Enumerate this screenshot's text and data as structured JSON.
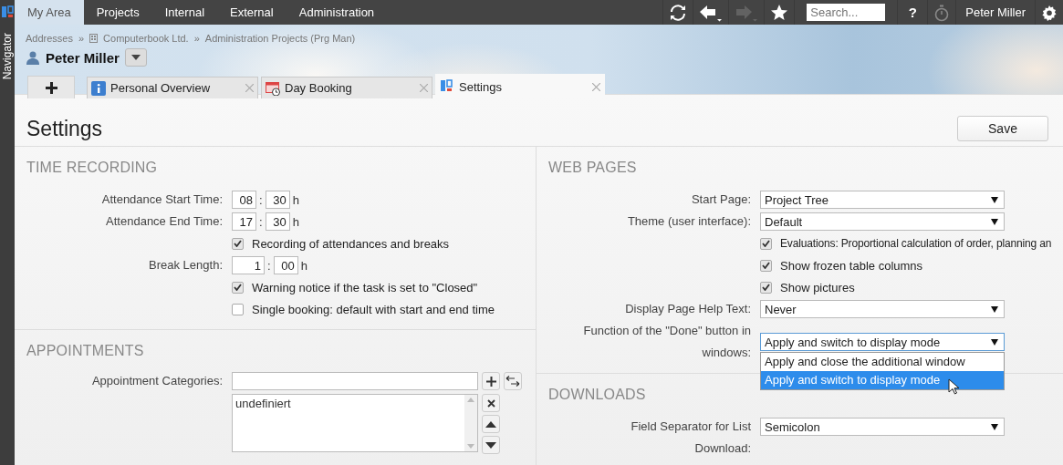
{
  "sidebar": {
    "label": "Navigator"
  },
  "menu": [
    {
      "label": "My Area",
      "selected": true
    },
    {
      "label": "Projects",
      "selected": false
    },
    {
      "label": "Internal",
      "selected": false
    },
    {
      "label": "External",
      "selected": false
    },
    {
      "label": "Administration",
      "selected": false
    }
  ],
  "toolbar": {
    "forward_disabled": true,
    "search": {
      "placeholder": "Search..."
    },
    "help": "?",
    "user": "Peter Miller"
  },
  "breadcrumbs": {
    "separator": "»",
    "items": [
      {
        "label": "Addresses",
        "kind": "plain"
      },
      {
        "label": "Computerbook Ltd.",
        "kind": "company"
      },
      {
        "label": "Administration Projects (Prg Man)",
        "kind": "plain"
      }
    ]
  },
  "person": {
    "name": "Peter Miller"
  },
  "tabs": [
    {
      "label": "Personal Overview",
      "kind": "info",
      "selected": false
    },
    {
      "label": "Day Booking",
      "kind": "calendar",
      "selected": false
    },
    {
      "label": "Settings",
      "kind": "settings",
      "selected": true
    }
  ],
  "page": {
    "title": "Settings",
    "save": "Save"
  },
  "left_column": [
    {
      "title": "TIME RECORDING",
      "rows": [
        {
          "kind": "time",
          "label": "Attendance Start Time:",
          "hours": "08",
          "separator": ":",
          "minutes": "30",
          "unit": "h"
        },
        {
          "kind": "time",
          "label": "Attendance End Time:",
          "hours": "17",
          "separator": ":",
          "minutes": "30",
          "unit": "h"
        },
        {
          "kind": "checkbox",
          "label": "Recording of attendances and breaks",
          "checked": true
        },
        {
          "kind": "time",
          "label": "Break Length:",
          "hours": "1",
          "separator": ":",
          "minutes": "00",
          "unit": "h"
        },
        {
          "kind": "checkbox",
          "label": "Warning notice if the task is set to \"Closed\"",
          "checked": true
        },
        {
          "kind": "checkbox",
          "label": "Single booking: default with start and end time",
          "checked": false
        }
      ]
    },
    {
      "title": "APPOINTMENTS",
      "rows": [
        {
          "kind": "list",
          "label": "Appointment Categories:",
          "items": [
            "undefiniert"
          ]
        }
      ]
    }
  ],
  "right_column": [
    {
      "title": "WEB PAGES",
      "rows": [
        {
          "kind": "select",
          "label": "Start Page:",
          "value": "Project Tree",
          "open": false
        },
        {
          "kind": "select",
          "label": "Theme (user interface):",
          "value": "Default",
          "open": false
        },
        {
          "kind": "checkbox",
          "label": "Evaluations: Proportional calculation of order, planning an",
          "checked": true
        },
        {
          "kind": "checkbox",
          "label": "Show frozen table columns",
          "checked": true
        },
        {
          "kind": "checkbox",
          "label": "Show pictures",
          "checked": true
        },
        {
          "kind": "select",
          "label": "Display Page Help Text:",
          "value": "Never",
          "open": false
        },
        {
          "kind": "select",
          "label": "Function of the \"Done\" button in windows:",
          "value": "Apply and switch to display mode",
          "open": true,
          "options": [
            {
              "label": "Apply and close the additional window",
              "selected": false
            },
            {
              "label": "Apply and switch to display mode",
              "selected": true
            }
          ]
        }
      ]
    },
    {
      "title": "DOWNLOADS",
      "rows": [
        {
          "kind": "select",
          "label": "Field Separator for List",
          "value": "Semicolon",
          "open": false
        },
        {
          "kind": "label",
          "label": "Download:"
        }
      ]
    }
  ]
}
